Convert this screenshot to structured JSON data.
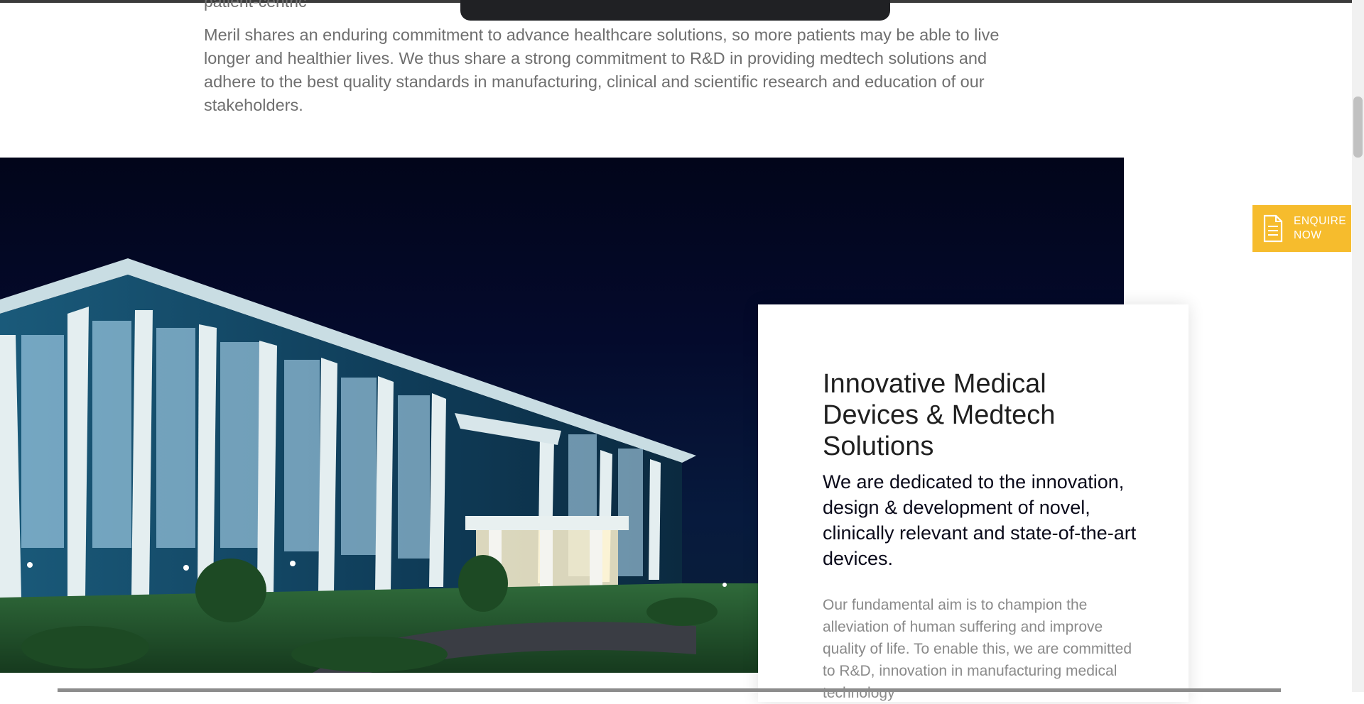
{
  "intro": {
    "cut_off_line": "patient-centric",
    "paragraph": "Meril shares an enduring commitment to advance healthcare solutions, so more patients may be able to live longer and healthier lives. We thus share a strong commitment to R&D in providing medtech solutions and adhere to the best quality standards in manufacturing, clinical and scientific research and education of our stakeholders."
  },
  "card": {
    "title": "Innovative Medical Devices & Medtech Solutions",
    "lead": "We are dedicated to the innovation, design & development of novel, clinically relevant and state-of-the-art devices.",
    "body": "Our fundamental aim is to champion the alleviation of human suffering and improve quality of life. To enable this, we are committed to R&D, innovation in manufacturing medical technology"
  },
  "enquire": {
    "label": "ENQUIRE NOW",
    "icon": "document-icon",
    "color": "#f6bc2d"
  },
  "colors": {
    "toast": "#202124",
    "text_gray": "#6f6f6f",
    "accent": "#f6bc2d"
  }
}
